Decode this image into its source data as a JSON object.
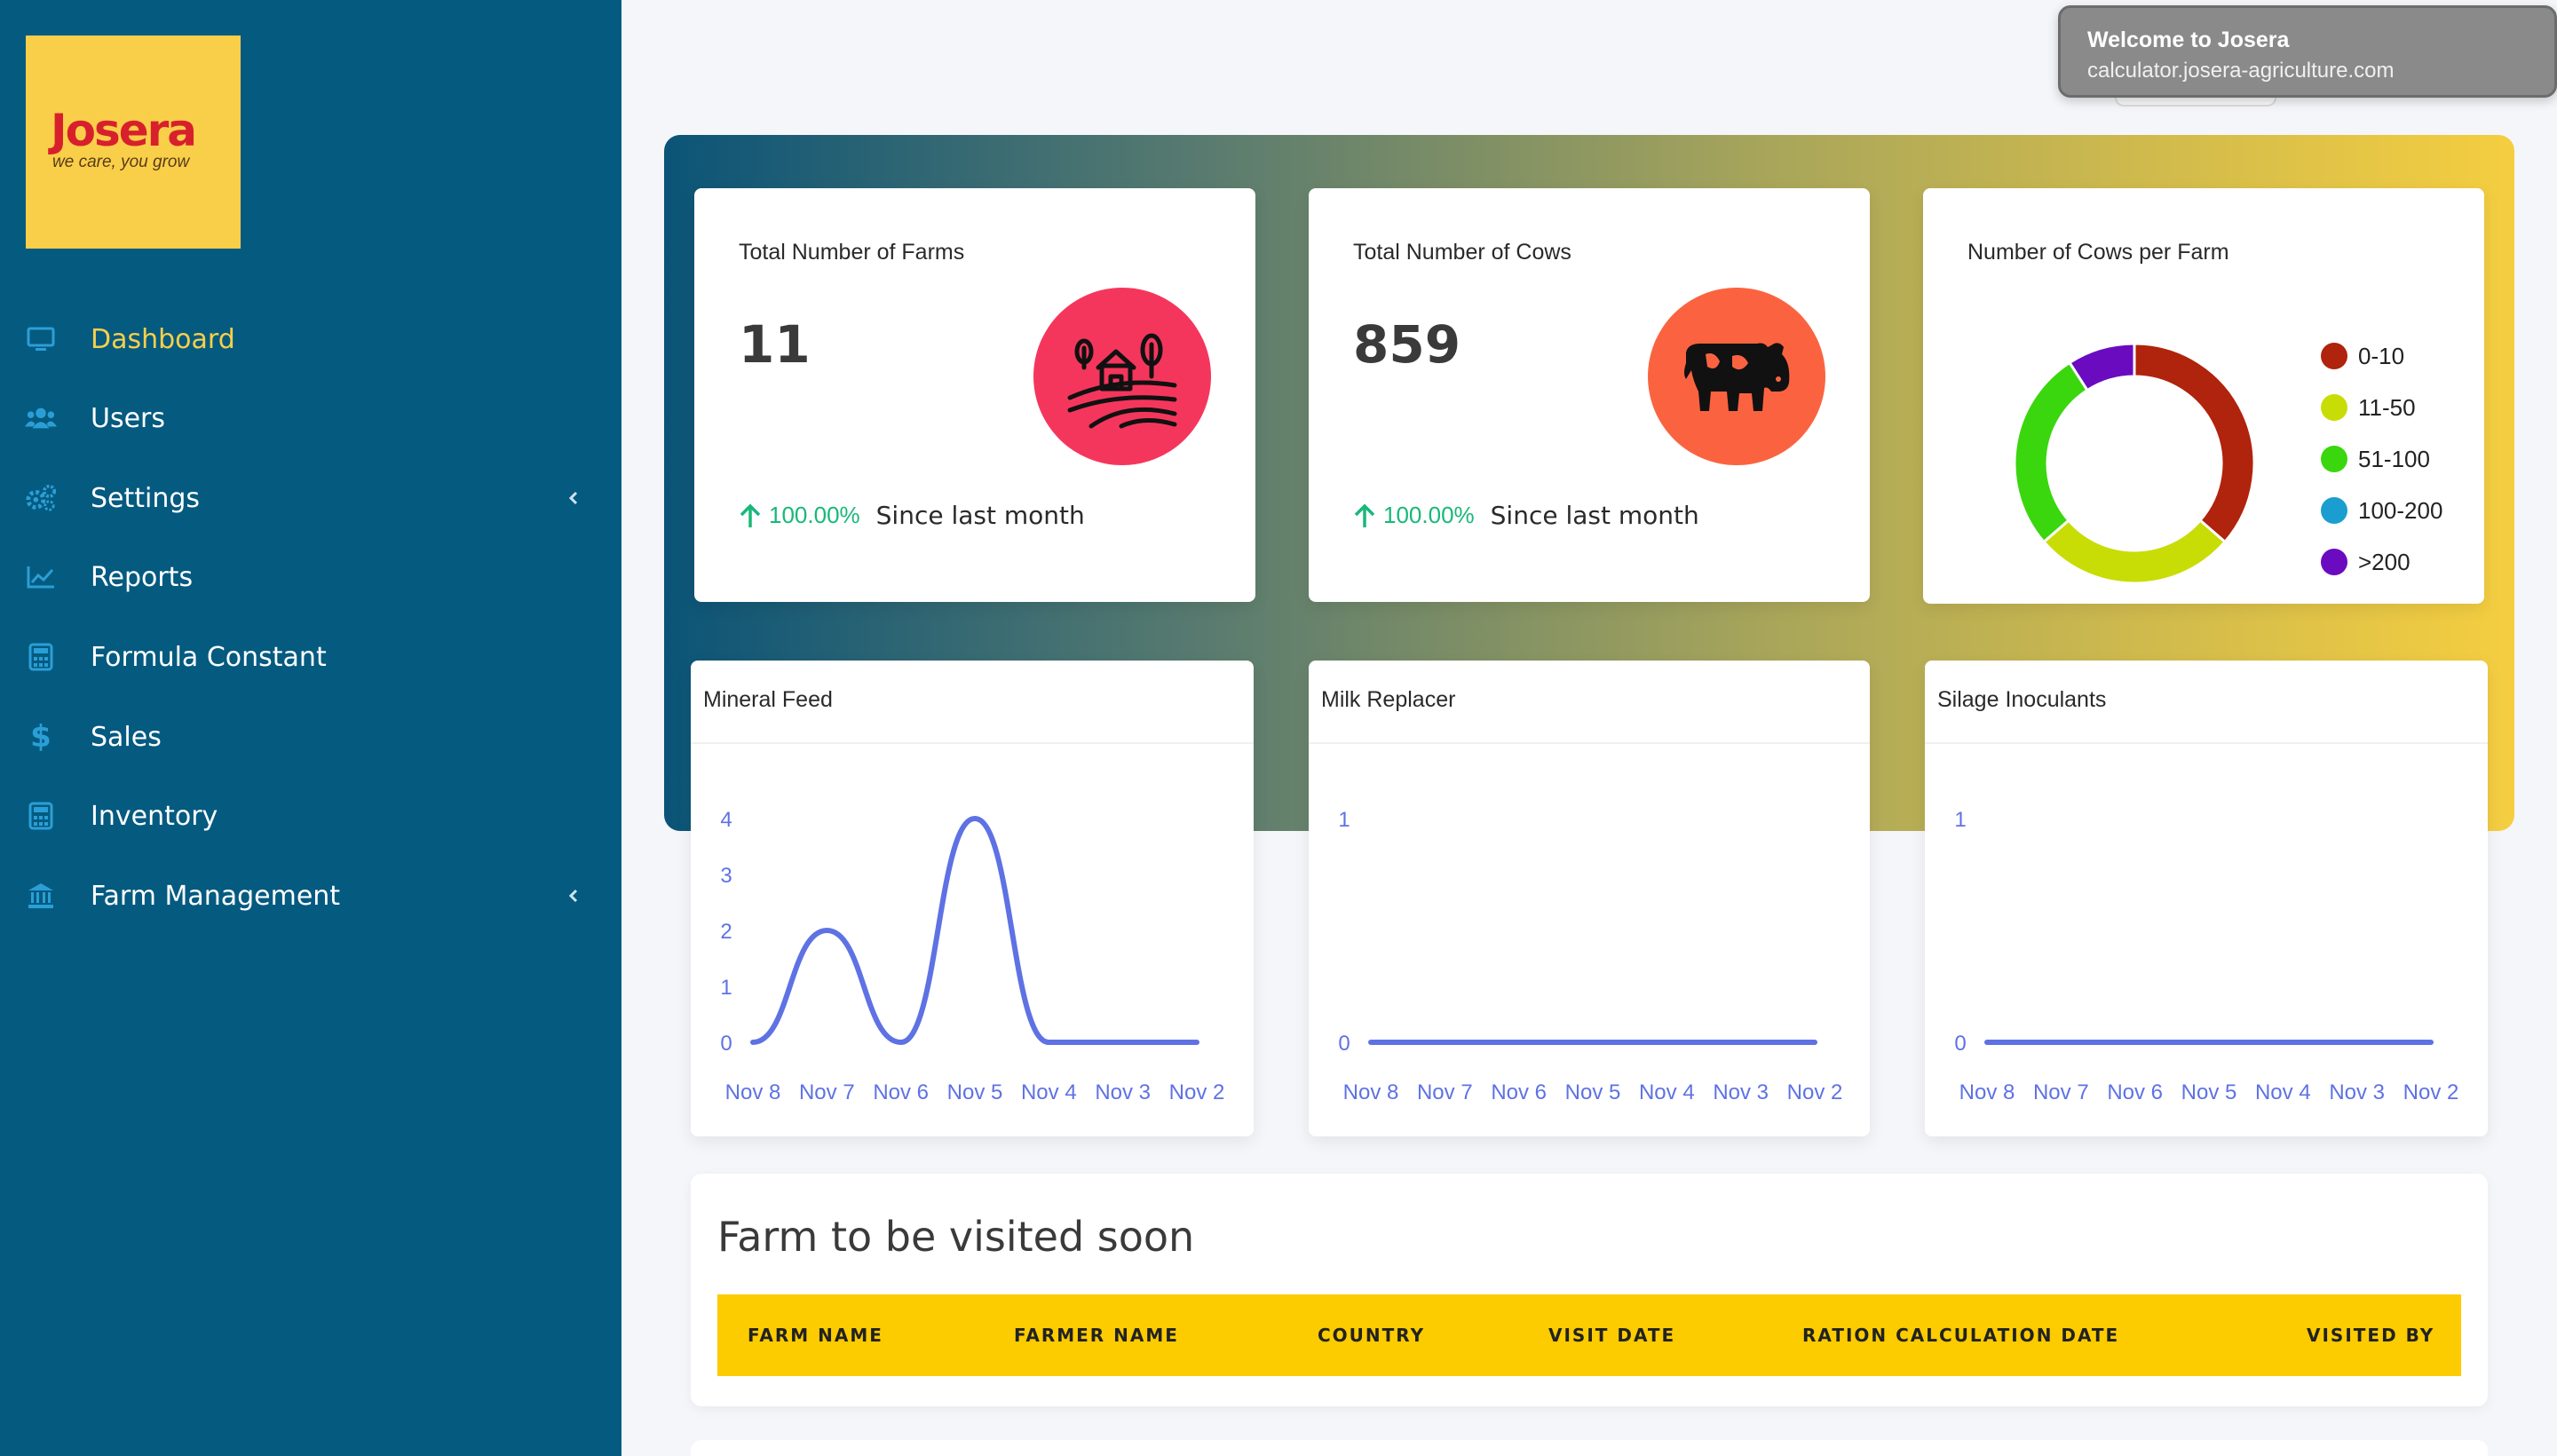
{
  "logo": {
    "word": "Josera",
    "tagline": "we care, you grow"
  },
  "toast": {
    "title": "Welcome to Josera",
    "subtitle": "calculator.josera-agriculture.com"
  },
  "sidebar": {
    "items": [
      {
        "label": "Dashboard",
        "icon": "monitor-icon",
        "active": true,
        "has_submenu": false
      },
      {
        "label": "Users",
        "icon": "users-icon",
        "active": false,
        "has_submenu": false
      },
      {
        "label": "Settings",
        "icon": "cogs-icon",
        "active": false,
        "has_submenu": true
      },
      {
        "label": "Reports",
        "icon": "chart-line-icon",
        "active": false,
        "has_submenu": false
      },
      {
        "label": "Formula Constant",
        "icon": "calculator-icon",
        "active": false,
        "has_submenu": false
      },
      {
        "label": "Sales",
        "icon": "dollar-icon",
        "active": false,
        "has_submenu": false
      },
      {
        "label": "Inventory",
        "icon": "calculator-icon",
        "active": false,
        "has_submenu": false
      },
      {
        "label": "Farm Management",
        "icon": "bank-icon",
        "active": false,
        "has_submenu": true
      }
    ]
  },
  "stats": {
    "farms": {
      "title": "Total Number of Farms",
      "value": "11",
      "change": "100.00%",
      "since": "Since last month",
      "icon": "farm-icon",
      "circle_color": "#f5365c"
    },
    "cows": {
      "title": "Total Number of Cows",
      "value": "859",
      "change": "100.00%",
      "since": "Since last month",
      "icon": "cow-icon",
      "circle_color": "#fb6340"
    }
  },
  "cows_per_farm": {
    "title": "Number of Cows per Farm",
    "legend": [
      {
        "label": "0-10",
        "color": "#b0230c"
      },
      {
        "label": "11-50",
        "color": "#c8dd05"
      },
      {
        "label": "51-100",
        "color": "#3ad60e"
      },
      {
        "label": "100-200",
        "color": "#1a9ed0"
      },
      {
        "label": ">200",
        "color": "#6a0bc0"
      }
    ]
  },
  "chart_data": [
    {
      "type": "pie",
      "title": "Number of Cows per Farm",
      "categories": [
        "0-10",
        "11-50",
        "51-100",
        "100-200",
        ">200"
      ],
      "values": [
        4,
        3,
        3,
        0,
        1
      ]
    },
    {
      "type": "line",
      "title": "Mineral Feed",
      "categories": [
        "Nov 8",
        "Nov 7",
        "Nov 6",
        "Nov 5",
        "Nov 4",
        "Nov 3",
        "Nov 2"
      ],
      "values": [
        0,
        2,
        0,
        4,
        0,
        0,
        0
      ],
      "y_ticks": [
        "0",
        "1",
        "2",
        "3",
        "4"
      ],
      "ylim": [
        0,
        4
      ]
    },
    {
      "type": "line",
      "title": "Milk Replacer",
      "categories": [
        "Nov 8",
        "Nov 7",
        "Nov 6",
        "Nov 5",
        "Nov 4",
        "Nov 3",
        "Nov 2"
      ],
      "values": [
        0,
        0,
        0,
        0,
        0,
        0,
        0
      ],
      "y_ticks": [
        "0",
        "1"
      ],
      "ylim": [
        0,
        1
      ]
    },
    {
      "type": "line",
      "title": "Silage Inoculants",
      "categories": [
        "Nov 8",
        "Nov 7",
        "Nov 6",
        "Nov 5",
        "Nov 4",
        "Nov 3",
        "Nov 2"
      ],
      "values": [
        0,
        0,
        0,
        0,
        0,
        0,
        0
      ],
      "y_ticks": [
        "0",
        "1"
      ],
      "ylim": [
        0,
        1
      ]
    }
  ],
  "visits_table": {
    "title": "Farm to be visited soon",
    "columns": [
      "FARM NAME",
      "FARMER NAME",
      "COUNTRY",
      "VISIT DATE",
      "RATION CALCULATION DATE",
      "VISITED BY"
    ]
  },
  "colors": {
    "sidebar": "#055a80",
    "accent": "#f9cf49",
    "line": "#5e72e4",
    "header": "#fccb00"
  }
}
